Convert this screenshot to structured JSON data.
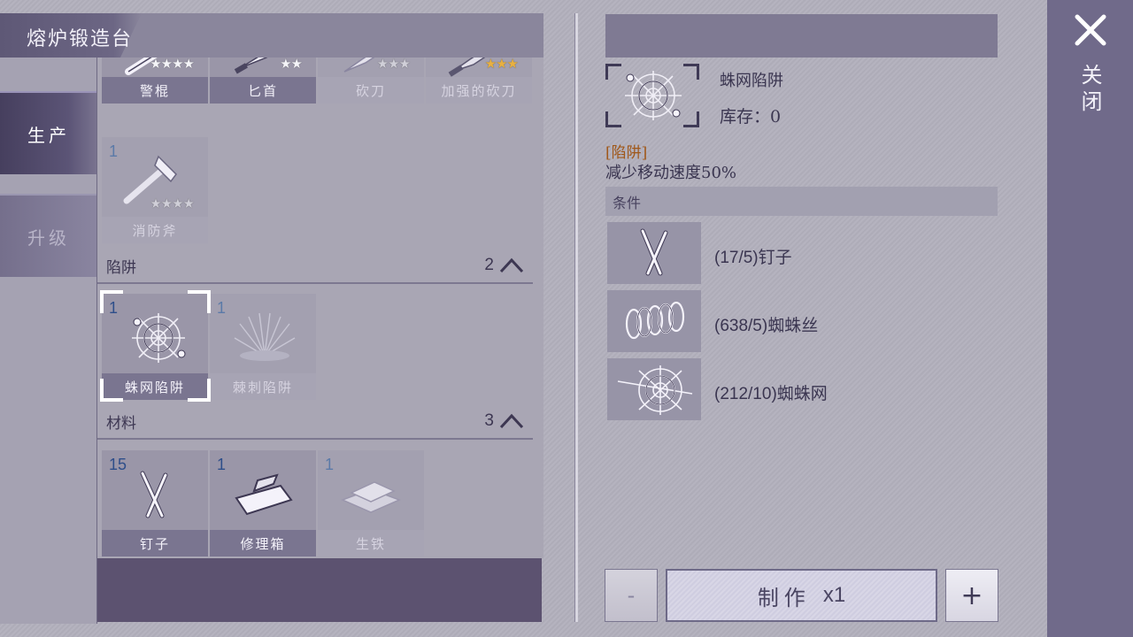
{
  "window": {
    "title": "熔炉锻造台"
  },
  "side_tabs": [
    {
      "label": "生产",
      "active": true
    },
    {
      "label": "升级",
      "active": false
    }
  ],
  "weapons_row": [
    {
      "name": "警棍",
      "stars": "★★★★",
      "star_style": "white"
    },
    {
      "name": "匕首",
      "stars": "★★",
      "star_style": "white"
    },
    {
      "name": "砍刀",
      "stars": "★★★",
      "star_style": "dim"
    },
    {
      "name": "加强的砍刀",
      "stars": "★★★",
      "star_style": "gold"
    }
  ],
  "extra_weapon": {
    "qty": "1",
    "name": "消防斧",
    "stars": "★★★★"
  },
  "sections": {
    "traps": {
      "label": "陷阱",
      "count": "2"
    },
    "materials": {
      "label": "材料",
      "count": "3"
    }
  },
  "traps": [
    {
      "qty": "1",
      "name": "蛛网陷阱",
      "selected": true
    },
    {
      "qty": "1",
      "name": "棘刺陷阱",
      "selected": false
    }
  ],
  "materials": [
    {
      "qty": "15",
      "name": "钉子"
    },
    {
      "qty": "1",
      "name": "修理箱"
    },
    {
      "qty": "1",
      "name": "生铁"
    }
  ],
  "detail": {
    "name": "蛛网陷阱",
    "stock": "库存：0",
    "tag": "[陷阱]",
    "description": "减少移动速度50%",
    "conditions_label": "条件",
    "conditions": [
      {
        "text": "(17/5)钉子",
        "icon": "nail-icon"
      },
      {
        "text": "(638/5)蜘蛛丝",
        "icon": "spider-silk-icon"
      },
      {
        "text": "(212/10)蜘蛛网",
        "icon": "spider-web-icon"
      }
    ]
  },
  "actions": {
    "minus": "-",
    "make": "制作",
    "make_count": "x1",
    "plus": "+"
  },
  "close": {
    "label": "关闭"
  },
  "colors": {
    "accent": "#706a8a",
    "tag": "#a0581a",
    "qty": "#2e4e8a"
  }
}
